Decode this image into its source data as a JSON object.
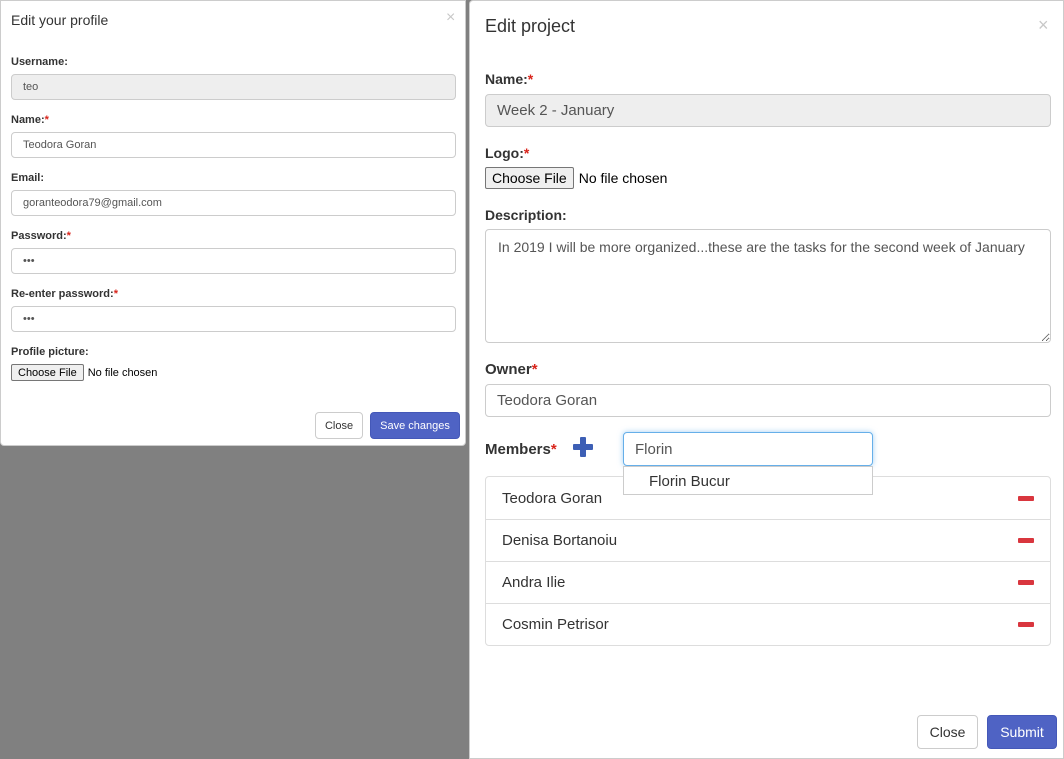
{
  "profile": {
    "title": "Edit your profile",
    "close_glyph": "×",
    "username": {
      "label": "Username:",
      "value": "teo"
    },
    "name": {
      "label": "Name:",
      "required": "*",
      "value": "Teodora Goran"
    },
    "email": {
      "label": "Email:",
      "value": "goranteodora79@gmail.com"
    },
    "password": {
      "label": "Password:",
      "required": "*",
      "value": "•••"
    },
    "reenter": {
      "label": "Re-enter password:",
      "required": "*",
      "value": "•••"
    },
    "picture": {
      "label": "Profile picture:",
      "button": "Choose File",
      "status": "No file chosen"
    },
    "close_button": "Close",
    "save_button": "Save changes"
  },
  "project": {
    "title": "Edit project",
    "close_glyph": "×",
    "name": {
      "label": "Name:",
      "required": "*",
      "value": "Week 2 - January"
    },
    "logo": {
      "label": "Logo:",
      "required": "*",
      "button": "Choose File",
      "status": "No file chosen"
    },
    "description": {
      "label": "Description:",
      "value": "In 2019 I will be more organized...these are the tasks for the second week of January"
    },
    "owner": {
      "label": "Owner",
      "required": "*",
      "value": "Teodora Goran"
    },
    "members": {
      "label": "Members",
      "required": "*",
      "search_value": "Florin",
      "suggestion": "Florin Bucur",
      "list": [
        "Teodora Goran",
        "Denisa Bortanoiu",
        "Andra Ilie",
        "Cosmin Petrisor"
      ]
    },
    "close_button": "Close",
    "submit_button": "Submit"
  },
  "colors": {
    "backdrop": "#808080",
    "primary": "#4f63c4",
    "required": "#d9241b",
    "remove": "#d9363e",
    "plus": "#3d5fb5"
  }
}
